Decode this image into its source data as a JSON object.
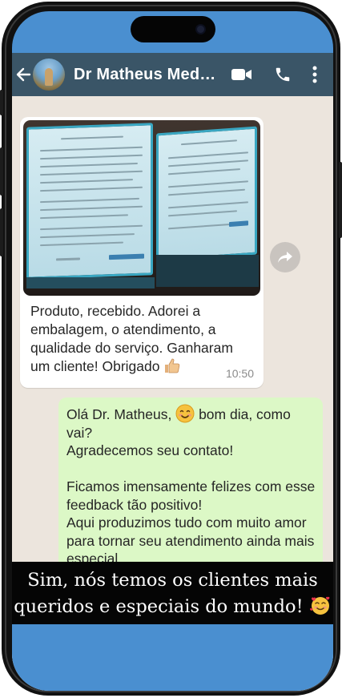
{
  "header": {
    "contact_name": "Dr Matheus Med…",
    "icons": [
      "back-arrow-icon",
      "avatar",
      "video-call-icon",
      "phone-call-icon",
      "more-options-icon"
    ]
  },
  "incoming_message": {
    "image": "photo of two boxed product packages with printed instructions",
    "text": "Produto, recebido. Adorei a embalagem, o atendimento, a qualidade do serviço. Ganharam um cliente! Obrigado",
    "emoji": "thumbs-up-icon",
    "time": "10:50"
  },
  "outgoing_message": {
    "lines": [
      "Olá Dr. Matheus,",
      "bom dia, como vai?",
      "Agradecemos seu contato!",
      "",
      "Ficamos imensamente  felizes com esse feedback tão positivo!",
      "Aqui produzimos tudo com muito amor para tornar seu atendimento ainda mais especial."
    ],
    "emoji": "smiling-face-icon"
  },
  "caption": {
    "line1": "Sim, nós temos os clientes mais",
    "line2": "queridos e especiais do mundo!",
    "emoji": "smiling-face-with-hearts-icon"
  },
  "colors": {
    "screen_background": "#4a8fd0",
    "header": "#3a5567",
    "chat_background": "#ece5dd",
    "incoming_bubble": "#ffffff",
    "outgoing_bubble": "#dcf8c6",
    "caption_band": "#050505"
  }
}
